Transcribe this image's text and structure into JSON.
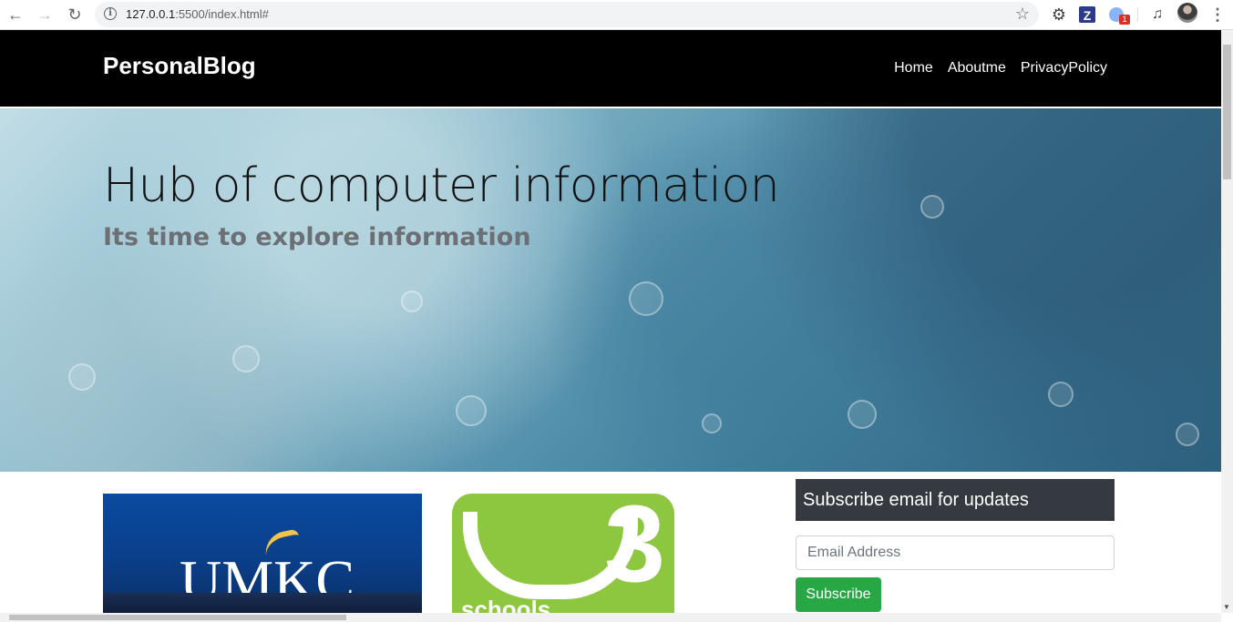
{
  "browser": {
    "url_host": "127.0.0.1",
    "url_rest": ":5500/index.html#",
    "ext_badge": "1",
    "ext_z": "Z"
  },
  "navbar": {
    "brand": "PersonalBlog",
    "links": [
      "Home",
      "Aboutme",
      "PrivacyPolicy"
    ]
  },
  "hero": {
    "title": "Hub of computer information",
    "subtitle": "Its time to explore information"
  },
  "cards": {
    "umkc_logo": "UMKC",
    "w3_label": "schools",
    "w3_mark": "3"
  },
  "subscribe": {
    "header": "Subscribe email for updates",
    "email_placeholder": "Email Address",
    "button": "Subscribe"
  },
  "colors": {
    "navbar_bg": "#000000",
    "subscribe_header_bg": "#343a40",
    "subscribe_button": "#28a745"
  }
}
